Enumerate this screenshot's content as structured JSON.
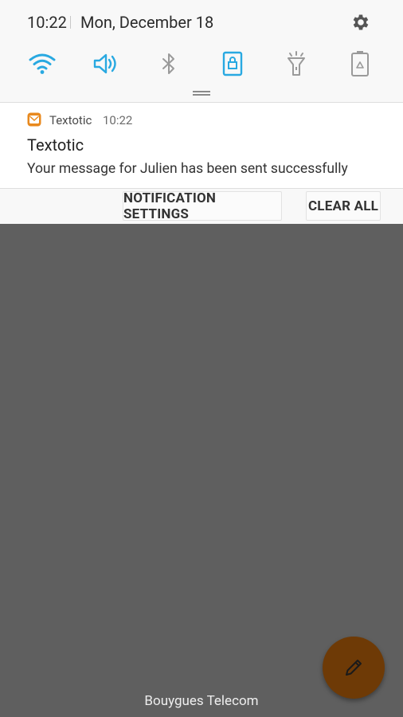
{
  "status_bar": {
    "time": "10:22",
    "date": "Mon, December 18"
  },
  "quick_settings": [
    {
      "name": "wifi",
      "icon": "wifi-icon",
      "active": true
    },
    {
      "name": "sound",
      "icon": "volume-icon",
      "active": true
    },
    {
      "name": "bluetooth",
      "icon": "bluetooth-icon",
      "active": false
    },
    {
      "name": "screen-rotation-lock",
      "icon": "lock-rotation-icon",
      "active": true
    },
    {
      "name": "flashlight",
      "icon": "flashlight-icon",
      "active": false
    },
    {
      "name": "power-saving",
      "icon": "battery-recycle-icon",
      "active": false
    }
  ],
  "notification": {
    "app_name": "Textotic",
    "time": "10:22",
    "title": "Textotic",
    "text": "Your message for Julien has been sent successfully"
  },
  "actions": {
    "settings_label": "NOTIFICATION SETTINGS",
    "clear_label": "CLEAR ALL"
  },
  "carrier": "Bouygues Telecom",
  "colors": {
    "accent": "#29a9e1",
    "inactive": "#9a9a9a",
    "fab": "#6e3a06",
    "scrim": "#5f5f5f"
  }
}
